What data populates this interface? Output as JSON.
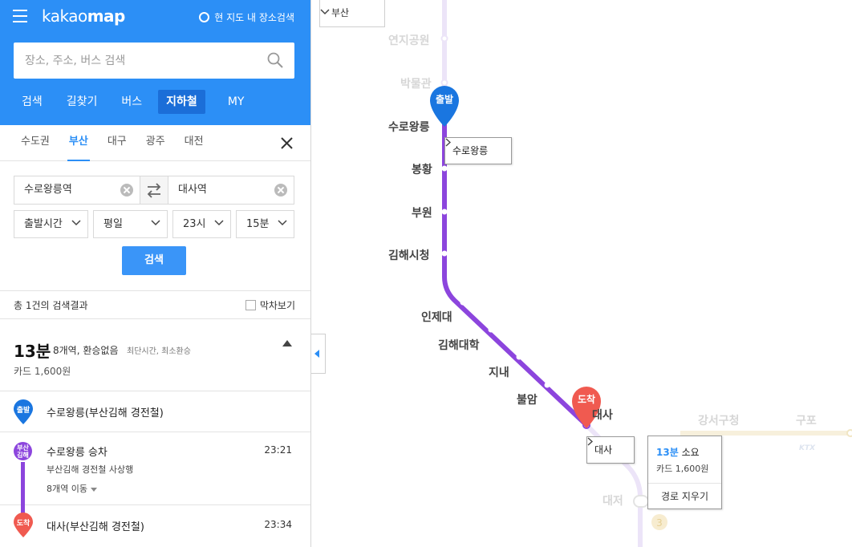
{
  "app": {
    "logo_light": "kakao",
    "logo_bold": "map",
    "map_search_toggle": "현 지도 내 장소검색"
  },
  "search": {
    "placeholder": "장소, 주소, 버스 검색"
  },
  "top_tabs": [
    "검색",
    "길찾기",
    "버스",
    "지하철",
    "MY"
  ],
  "top_tabs_active": "지하철",
  "region_tabs": [
    "수도권",
    "부산",
    "대구",
    "광주",
    "대전"
  ],
  "region_tabs_active": "부산",
  "route": {
    "from": "수로왕릉역",
    "to": "대사역",
    "time_type": "출발시간",
    "day": "평일",
    "hour": "23시",
    "minute": "15분",
    "search_label": "검색"
  },
  "results": {
    "count_text": "총 1건의 검색결과",
    "last_train_label": "막차보기",
    "duration": "13분",
    "stops_info": "8개역, 환승없음",
    "tags": "최단시간, 최소환승",
    "fare": "카드 1,600원"
  },
  "steps": {
    "depart": {
      "badge": "출발",
      "text": "수로왕릉(부산김해 경전철)"
    },
    "ride": {
      "badge_top": "부산",
      "badge_bottom": "김해",
      "text": "수로왕릉 승차",
      "time": "23:21",
      "line": "부산김해 경전철 사상행",
      "stops": "8개역 이동"
    },
    "arrive": {
      "badge": "도착",
      "text": "대사(부산김해 경전철)",
      "time": "23:34"
    }
  },
  "map": {
    "region_select": "부산",
    "stations_active": [
      "수로왕릉",
      "봉황",
      "부원",
      "김해시청",
      "인제대",
      "김해대학",
      "지내",
      "불암",
      "대사"
    ],
    "stations_faded": [
      "연지공원",
      "박물관",
      "강서구청",
      "구포",
      "대저"
    ],
    "start_pin": "출발",
    "end_pin": "도착",
    "callout_start": "수로왕릉",
    "callout_end": "대사",
    "ktx_label": "KTX",
    "line3_badge": "3",
    "popup": {
      "duration_value": "13분",
      "duration_suffix": "소요",
      "fare": "카드 1,600원",
      "clear_label": "경로 지우기"
    },
    "line_color": "#8c45dd",
    "faded_line_color": "#ece4f8",
    "start_pin_color": "#1a76e0",
    "end_pin_color": "#f05a50"
  }
}
